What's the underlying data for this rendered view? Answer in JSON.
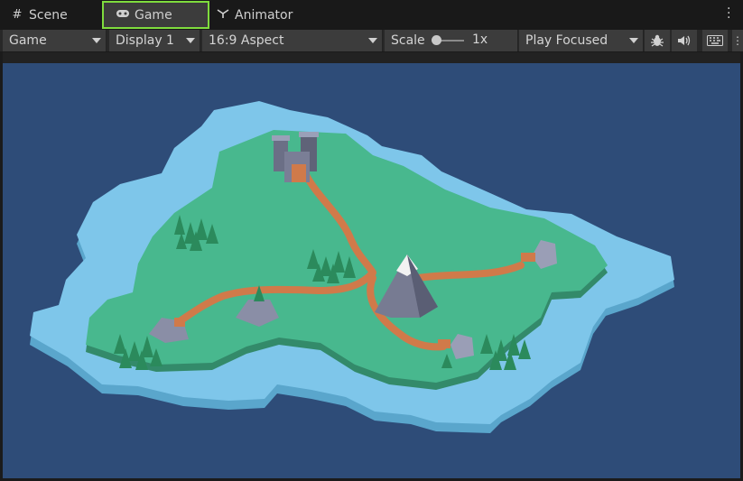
{
  "tabs": {
    "scene": {
      "label": "Scene",
      "icon": "grid-icon"
    },
    "game": {
      "label": "Game",
      "icon": "gamepad-icon"
    },
    "animator": {
      "label": "Animator",
      "icon": "animator-icon"
    }
  },
  "toolbar": {
    "game_view": "Game",
    "display": "Display 1",
    "aspect": "16:9 Aspect",
    "scale_label": "Scale",
    "scale_value": "1x",
    "play_mode": "Play Focused",
    "icons": [
      "bug-icon",
      "audio-icon",
      "keyboard-icon"
    ]
  },
  "colors": {
    "accent_outline": "#7fdc3d",
    "viewport_bg": "#2e4c78",
    "water": "#7ec6ea",
    "grass": "#48b88e",
    "path": "#d07a4a"
  }
}
